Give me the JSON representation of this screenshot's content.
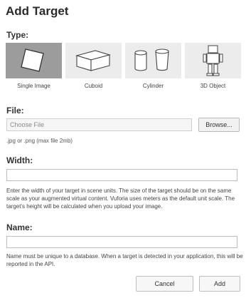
{
  "dialog": {
    "title": "Add Target"
  },
  "type_section": {
    "label": "Type:",
    "selected": "Single Image",
    "options": [
      {
        "label": "Single Image",
        "icon": "single-image-icon"
      },
      {
        "label": "Cuboid",
        "icon": "cuboid-icon"
      },
      {
        "label": "Cylinder",
        "icon": "cylinder-icon"
      },
      {
        "label": "3D Object",
        "icon": "3d-object-icon"
      }
    ]
  },
  "file_section": {
    "label": "File:",
    "placeholder": "Choose File",
    "browse_label": "Browse...",
    "hint": ".jpg or .png (max file 2mb)"
  },
  "width_section": {
    "label": "Width:",
    "value": "",
    "help": "Enter the width of your target in scene units. The size of the target should be on the same scale as your augmented virtual content. Vuforia uses meters as the default unit scale. The target's height will be calculated when you upload your image."
  },
  "name_section": {
    "label": "Name:",
    "value": "",
    "help": "Name must be unique to a database. When a target is detected in your application, this will be reported in the API."
  },
  "actions": {
    "cancel_label": "Cancel",
    "add_label": "Add"
  },
  "colors": {
    "selected_tile": "#9c9c9c",
    "tile": "#ececec",
    "input_border": "#bdbdbd"
  }
}
